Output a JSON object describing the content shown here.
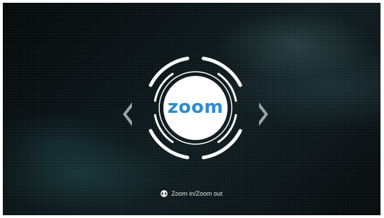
{
  "app": {
    "logo_text": "zoom"
  },
  "controls": {
    "prev_icon": "chevron-left-icon",
    "next_icon": "chevron-right-icon"
  },
  "hint": {
    "icon": "remote-dpad-icon",
    "text": "Zoom in/Zoom out"
  },
  "colors": {
    "logo_blue": "#2d8cd0",
    "ring_white": "#ffffff",
    "arrow_gray": "#9aa4a8"
  }
}
